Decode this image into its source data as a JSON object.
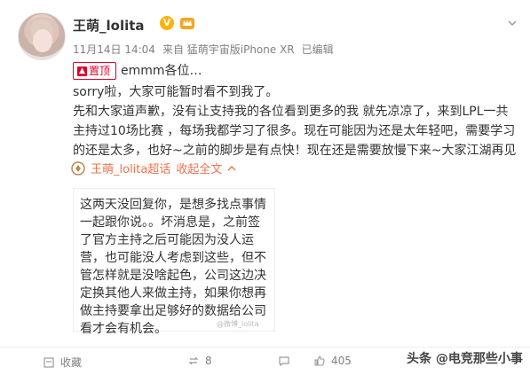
{
  "post": {
    "author": "王萌_lolita",
    "verified_badge": "V",
    "time": "11月14日 14:04",
    "source": "来自 猛萌宇宙版iPhone XR",
    "edited": "已编辑",
    "pin_label": "置顶",
    "pin_title": "emmm各位…",
    "paragraphs": [
      "sorry啦，大家可能暂时看不到我了。",
      "先和大家道声歉，没有让支持我的各位看到更多的我 就先凉凉了，来到LPL一共主持过10场比赛 ，每场我都学习了很多。现在可能因为还是太年轻吧，需要学习的还是太多，也好~之前的脚步是有点快！现在还是需要放慢下来~大家江湖再见"
    ],
    "supertopic_link": "王萌_lolita超话",
    "collapse_label": "收起全文",
    "quoted_text": "这两天没回复你，是想多找点事情一起跟你说。。坏消息是，之前签了官方主持之后可能因为没人运营，也可能没人考虑到这些，但不管怎样就是没啥起色，公司这边决定换其他人来做主持，如果你想再做主持要拿出足够好的数据给公司看才会有机会。",
    "watermark": "@微博_lolita"
  },
  "actions": {
    "favorite_label": "收藏",
    "repost_count": "8",
    "comment_count": "",
    "like_count": "405"
  },
  "footer": {
    "source_watermark": "头条 @电竞那些小事"
  },
  "colors": {
    "pin_red": "#e0002a",
    "link_orange": "#eb7350",
    "meta_gray": "#808080"
  }
}
